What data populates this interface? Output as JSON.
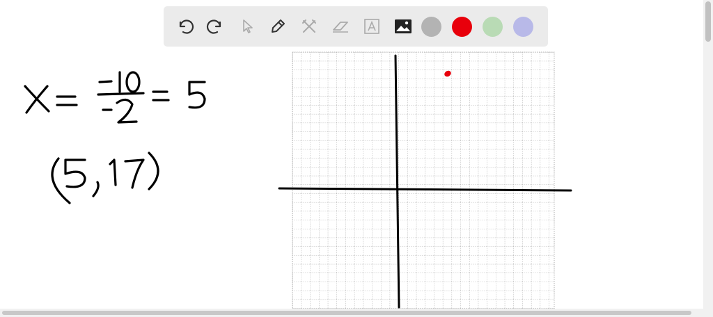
{
  "toolbar": {
    "tools": [
      {
        "name": "undo-icon",
        "enabled": true
      },
      {
        "name": "redo-icon",
        "enabled": true
      },
      {
        "name": "select-pointer-icon",
        "enabled": false
      },
      {
        "name": "pencil-icon",
        "enabled": true
      },
      {
        "name": "tools-cross-icon",
        "enabled": false
      },
      {
        "name": "eraser-icon",
        "enabled": false
      },
      {
        "name": "text-tool-icon",
        "enabled": false
      },
      {
        "name": "image-icon",
        "enabled": true
      }
    ],
    "colors": [
      "#b3b3b3",
      "#e8000b",
      "#b9dbb5",
      "#b8b9e8"
    ],
    "selected_color": "#e8000b"
  },
  "whiteboard": {
    "equation": {
      "lhs": "X =",
      "numerator": "-10",
      "denominator": "-2",
      "rhs": "= 5"
    },
    "point": "(5, 17)"
  },
  "graph": {
    "grid": true,
    "ink_color": "#e8000b"
  }
}
